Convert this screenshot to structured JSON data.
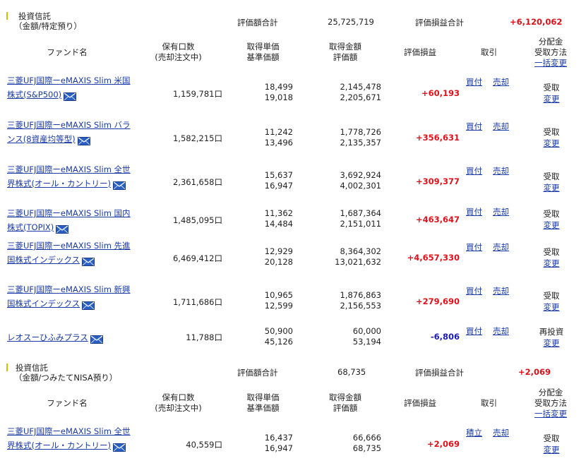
{
  "sections": [
    {
      "title1": "投資信託",
      "title2": "（金額/特定預り）",
      "total_label": "評価額合計",
      "total_value": "25,725,719",
      "pl_label": "評価損益合計",
      "pl_value": "+6,120,062",
      "headers": {
        "fund": "ファンド名",
        "units1": "保有口数",
        "units2": "(売却注文中)",
        "price1": "取得単価",
        "price2": "基準価額",
        "amount1": "取得金額",
        "amount2": "評価額",
        "pl": "評価損益",
        "trade": "取引",
        "dist1": "分配金",
        "dist2": "受取方法",
        "dist_link": "一括変更"
      },
      "rows": [
        {
          "name": "三菱UFJ国際ーeMAXIS Slim 米国株式(S&P500)",
          "units": "1,159,781口",
          "price": "18,499",
          "nav": "19,018",
          "cost": "2,145,478",
          "value": "2,205,671",
          "pl": "+60,193",
          "pl_sign": "pos",
          "buy": "買付",
          "sell": "売却",
          "dist": "受取",
          "change": "変更"
        },
        {
          "name": "三菱UFJ国際ーeMAXIS Slim バランス(8資産均等型)",
          "units": "1,582,215口",
          "price": "11,242",
          "nav": "13,496",
          "cost": "1,778,726",
          "value": "2,135,357",
          "pl": "+356,631",
          "pl_sign": "pos",
          "buy": "買付",
          "sell": "売却",
          "dist": "受取",
          "change": "変更"
        },
        {
          "name": "三菱UFJ国際ーeMAXIS Slim 全世界株式(オール・カントリー)",
          "units": "2,361,658口",
          "price": "15,637",
          "nav": "16,947",
          "cost": "3,692,924",
          "value": "4,002,301",
          "pl": "+309,377",
          "pl_sign": "pos",
          "buy": "買付",
          "sell": "売却",
          "dist": "受取",
          "change": "変更"
        },
        {
          "name": "三菱UFJ国際ーeMAXIS Slim 国内株式(TOPIX)",
          "units": "1,485,095口",
          "price": "11,362",
          "nav": "14,484",
          "cost": "1,687,364",
          "value": "2,151,011",
          "pl": "+463,647",
          "pl_sign": "pos",
          "buy": "買付",
          "sell": "売却",
          "dist": "受取",
          "change": "変更"
        },
        {
          "name": "三菱UFJ国際ーeMAXIS Slim 先進国株式インデックス",
          "units": "6,469,412口",
          "price": "12,929",
          "nav": "20,128",
          "cost": "8,364,302",
          "value": "13,021,632",
          "pl": "+4,657,330",
          "pl_sign": "pos",
          "buy": "買付",
          "sell": "売却",
          "dist": "受取",
          "change": "変更"
        },
        {
          "name": "三菱UFJ国際ーeMAXIS Slim 新興国株式インデックス",
          "units": "1,711,686口",
          "price": "10,965",
          "nav": "12,599",
          "cost": "1,876,863",
          "value": "2,156,553",
          "pl": "+279,690",
          "pl_sign": "pos",
          "buy": "買付",
          "sell": "売却",
          "dist": "受取",
          "change": "変更"
        },
        {
          "name": "レオスーひふみプラス",
          "units": "11,788口",
          "price": "50,900",
          "nav": "45,126",
          "cost": "60,000",
          "value": "53,194",
          "pl": "-6,806",
          "pl_sign": "neg",
          "buy": "買付",
          "sell": "売却",
          "dist": "再投資",
          "change": "変更"
        }
      ]
    },
    {
      "title1": "投資信託",
      "title2": "（金額/つみたてNISA預り）",
      "total_label": "評価額合計",
      "total_value": "68,735",
      "pl_label": "評価損益合計",
      "pl_value": "+2,069",
      "headers": {
        "fund": "ファンド名",
        "units1": "保有口数",
        "units2": "(売却注文中)",
        "price1": "取得単価",
        "price2": "基準価額",
        "amount1": "取得金額",
        "amount2": "評価額",
        "pl": "評価損益",
        "trade": "取引",
        "dist1": "分配金",
        "dist2": "受取方法",
        "dist_link": "一括変更"
      },
      "rows": [
        {
          "name": "三菱UFJ国際ーeMAXIS Slim 全世界株式(オール・カントリー)",
          "units": "40,559口",
          "price": "16,437",
          "nav": "16,947",
          "cost": "66,666",
          "value": "68,735",
          "pl": "+2,069",
          "pl_sign": "pos",
          "buy": "積立",
          "sell": "売却",
          "dist": "受取",
          "change": "変更"
        }
      ]
    }
  ]
}
